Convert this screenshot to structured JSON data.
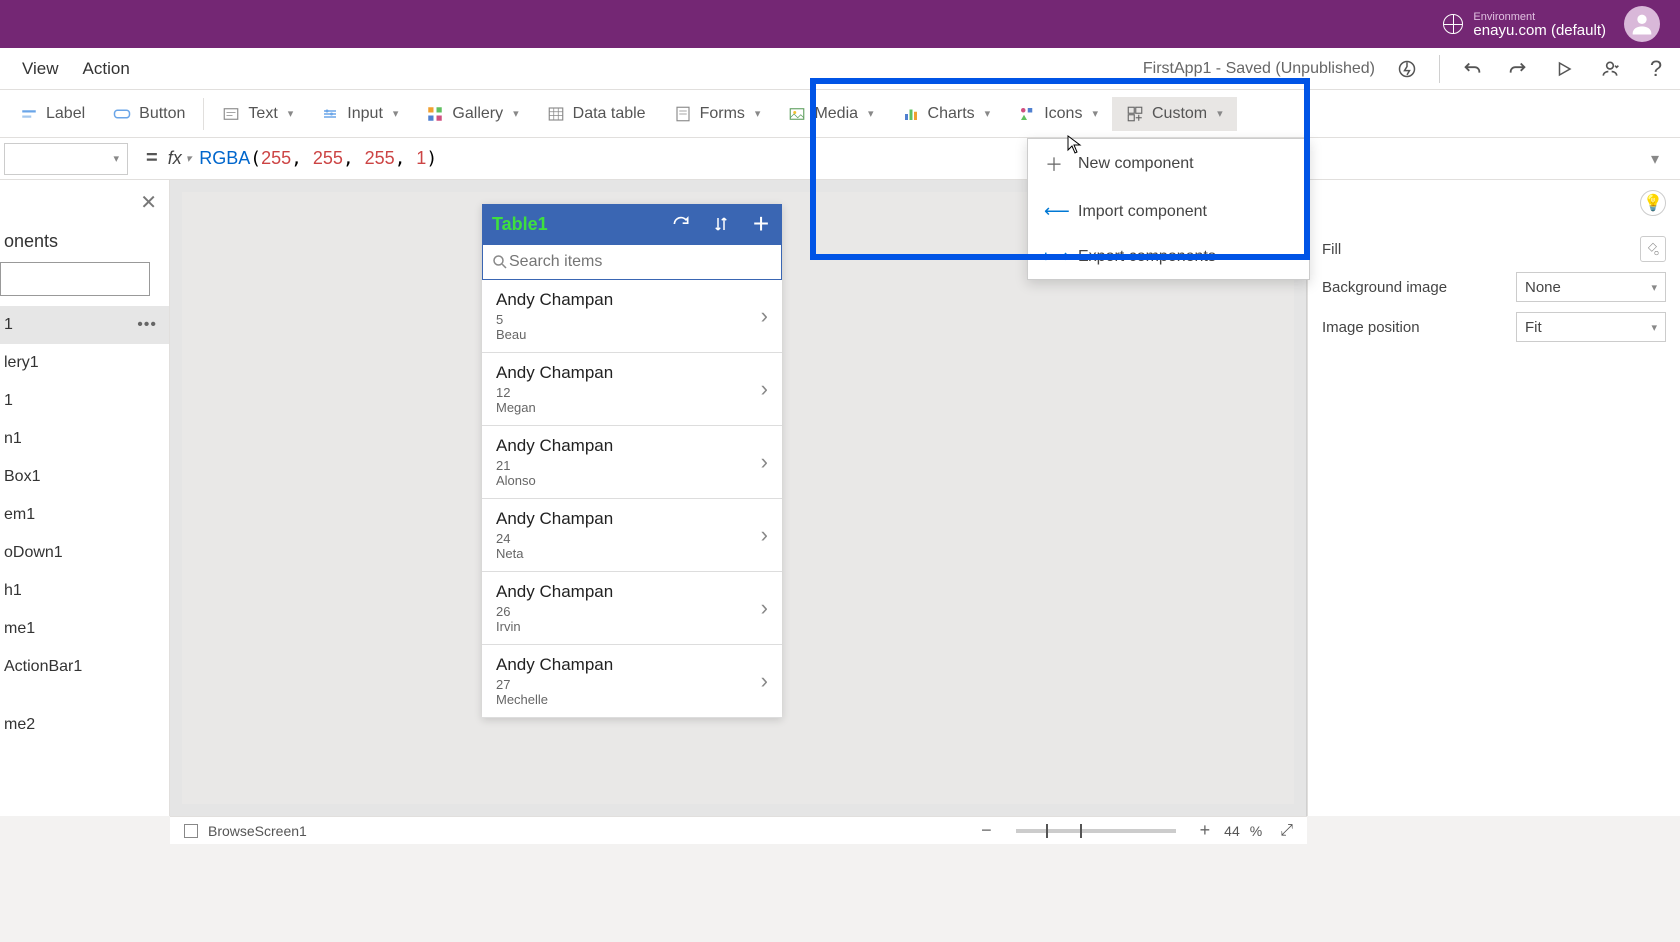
{
  "header": {
    "envLabel": "Environment",
    "envValue": "enayu.com (default)"
  },
  "menu": {
    "view": "View",
    "action": "Action"
  },
  "appStatus": "FirstApp1 - Saved (Unpublished)",
  "ribbon": {
    "label": "Label",
    "button": "Button",
    "text": "Text",
    "input": "Input",
    "gallery": "Gallery",
    "datatable": "Data table",
    "forms": "Forms",
    "media": "Media",
    "charts": "Charts",
    "icons": "Icons",
    "custom": "Custom"
  },
  "formula": {
    "equals": "=",
    "fx": "fx",
    "fn": "RGBA",
    "a1": "255",
    "a2": "255",
    "a3": "255",
    "a4": "1"
  },
  "tree": {
    "heading": "onents",
    "selected": "1",
    "items": [
      "lery1",
      "1",
      "n1",
      "Box1",
      "em1",
      "oDown1",
      "h1",
      "me1",
      "ActionBar1",
      "",
      "me2"
    ]
  },
  "phone": {
    "title": "Table1",
    "searchPlaceholder": "Search items",
    "rows": [
      {
        "title": "Andy Champan",
        "sub1": "5",
        "sub2": "Beau"
      },
      {
        "title": "Andy Champan",
        "sub1": "12",
        "sub2": "Megan"
      },
      {
        "title": "Andy Champan",
        "sub1": "21",
        "sub2": "Alonso"
      },
      {
        "title": "Andy Champan",
        "sub1": "24",
        "sub2": "Neta"
      },
      {
        "title": "Andy Champan",
        "sub1": "26",
        "sub2": "Irvin"
      },
      {
        "title": "Andy Champan",
        "sub1": "27",
        "sub2": "Mechelle"
      }
    ]
  },
  "props": {
    "fill": "Fill",
    "bgImage": "Background image",
    "bgImageVal": "None",
    "imgPos": "Image position",
    "imgPosVal": "Fit"
  },
  "dropdown": {
    "new": "New component",
    "import": "Import component",
    "export": "Export components"
  },
  "status": {
    "screenName": "BrowseScreen1",
    "zoom": "44",
    "pct": "%"
  }
}
